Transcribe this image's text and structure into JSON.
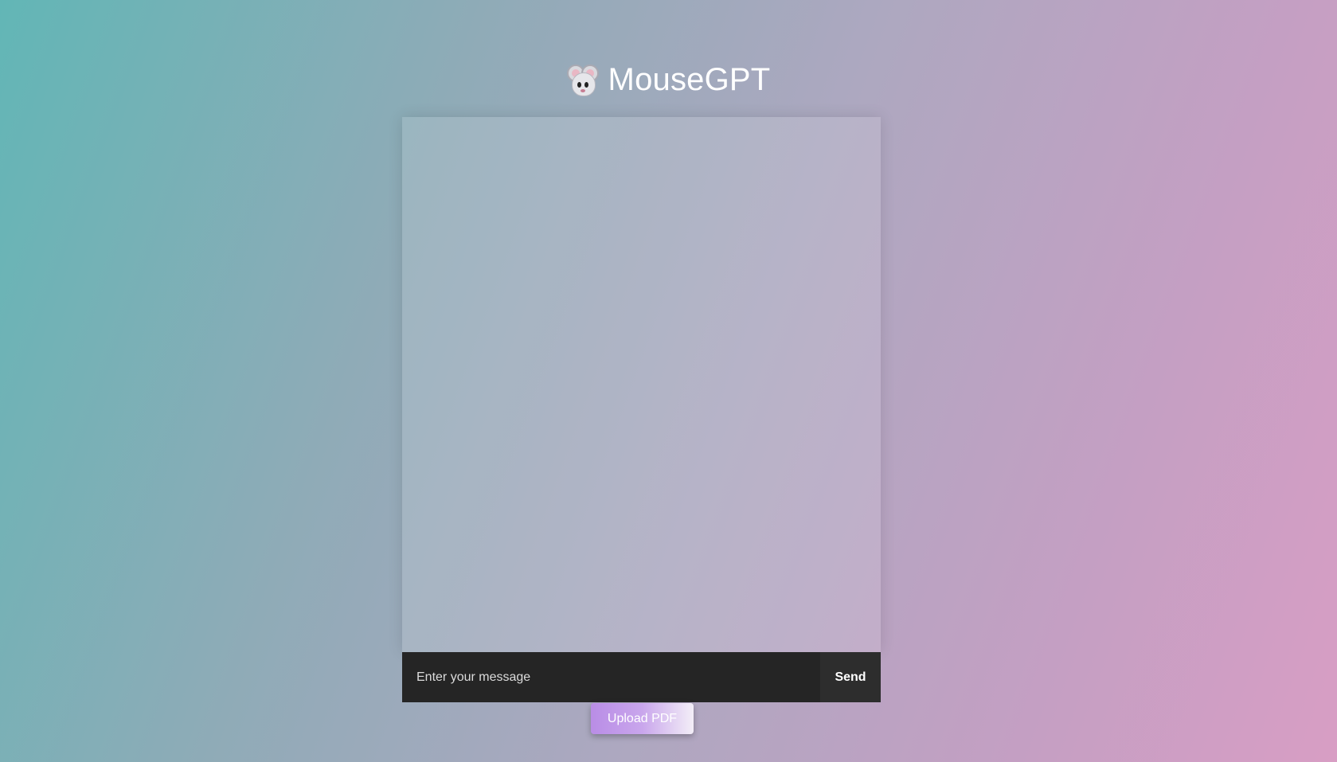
{
  "app": {
    "title": "MouseGPT",
    "logo_icon": "mouse-face-icon"
  },
  "chat": {
    "messages": []
  },
  "composer": {
    "placeholder": "Enter your message",
    "value": "",
    "send_label": "Send"
  },
  "upload": {
    "label": "Upload PDF"
  },
  "colors": {
    "gradient_start": "#62b6b6",
    "gradient_end": "#d89ec4",
    "input_bar": "#252525",
    "upload_accent": "#b98de6"
  }
}
